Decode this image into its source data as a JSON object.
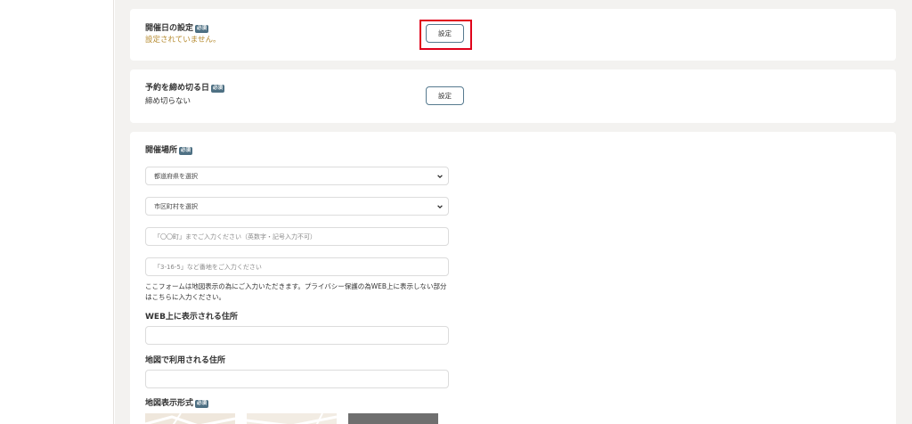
{
  "colors": {
    "accent": "#4e7083",
    "warning_text": "#b58a2e",
    "highlight": "#e0001b",
    "page_bg": "#f3f2f0"
  },
  "required_badge": "必須",
  "sections": {
    "event_date": {
      "title": "開催日の設定",
      "status": "設定されていません。",
      "button_label": "設定"
    },
    "deadline": {
      "title": "予約を締め切る日",
      "value": "締め切らない",
      "button_label": "設定"
    },
    "venue": {
      "title": "開催場所",
      "prefecture_select": "都道府県を選択",
      "city_select": "市区町村を選択",
      "town_placeholder": "「〇〇町」までご入力ください（英数字・記号入力不可）",
      "block_placeholder": "「3-16-5」など番地をご入力ください",
      "note": "ここフォームは地図表示の為にご入力いただきます。プライバシー保護の為WEB上に表示しない部分はこちらに入力ください。",
      "web_address_label": "WEB上に表示される住所",
      "map_address_label": "地図で利用される住所",
      "map_display_label": "地図表示形式"
    }
  }
}
